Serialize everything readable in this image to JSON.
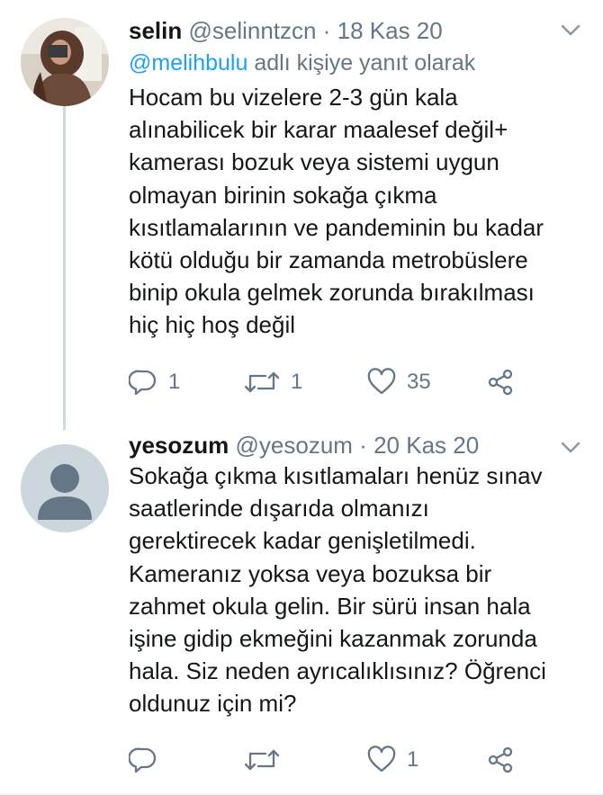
{
  "tweets": [
    {
      "author_name": "selin",
      "handle": "@selinntzcn",
      "separator": "·",
      "date": "18 Kas 20",
      "reply_to_handle": "@melihbulu",
      "reply_suffix": "adlı kişiye yanıt olarak",
      "text": "Hocam bu vizelere 2-3 gün kala\nalınabilicek bir karar maalesef değil+\nkamerası bozuk veya sistemi uygun\nolmayan birinin sokağa çıkma\nkısıtlamalarının ve pandeminin bu kadar\nkötü olduğu bir zamanda metrobüslere\nbinip okula gelmek zorunda bırakılması\nhiç hiç hoş değil",
      "reply_count": "1",
      "retweet_count": "1",
      "like_count": "35"
    },
    {
      "author_name": "yesozum",
      "handle": "@yesozum",
      "separator": "·",
      "date": "20 Kas 20",
      "text": "Sokağa çıkma kısıtlamaları henüz sınav\nsaatlerinde dışarıda olmanızı\ngerektirecek kadar genişletilmedi.\nKameranız yoksa veya bozuksa bir\nzahmet okula gelin. Bir sürü insan hala\nişine gidip ekmeğini kazanmak zorunda\nhala. Siz neden ayrıcalıklısınız? Öğrenci\noldunuz için mi?",
      "like_count": "1"
    }
  ],
  "icons": {
    "reply": "reply-icon",
    "retweet": "retweet-icon",
    "like": "heart-icon",
    "share": "share-icon",
    "more": "chevron-down-icon"
  },
  "colors": {
    "text": "#14171a",
    "secondary": "#657786",
    "link": "#1da1f2",
    "thread_line": "#cfd9de",
    "default_avatar": "#ccd6dd"
  }
}
